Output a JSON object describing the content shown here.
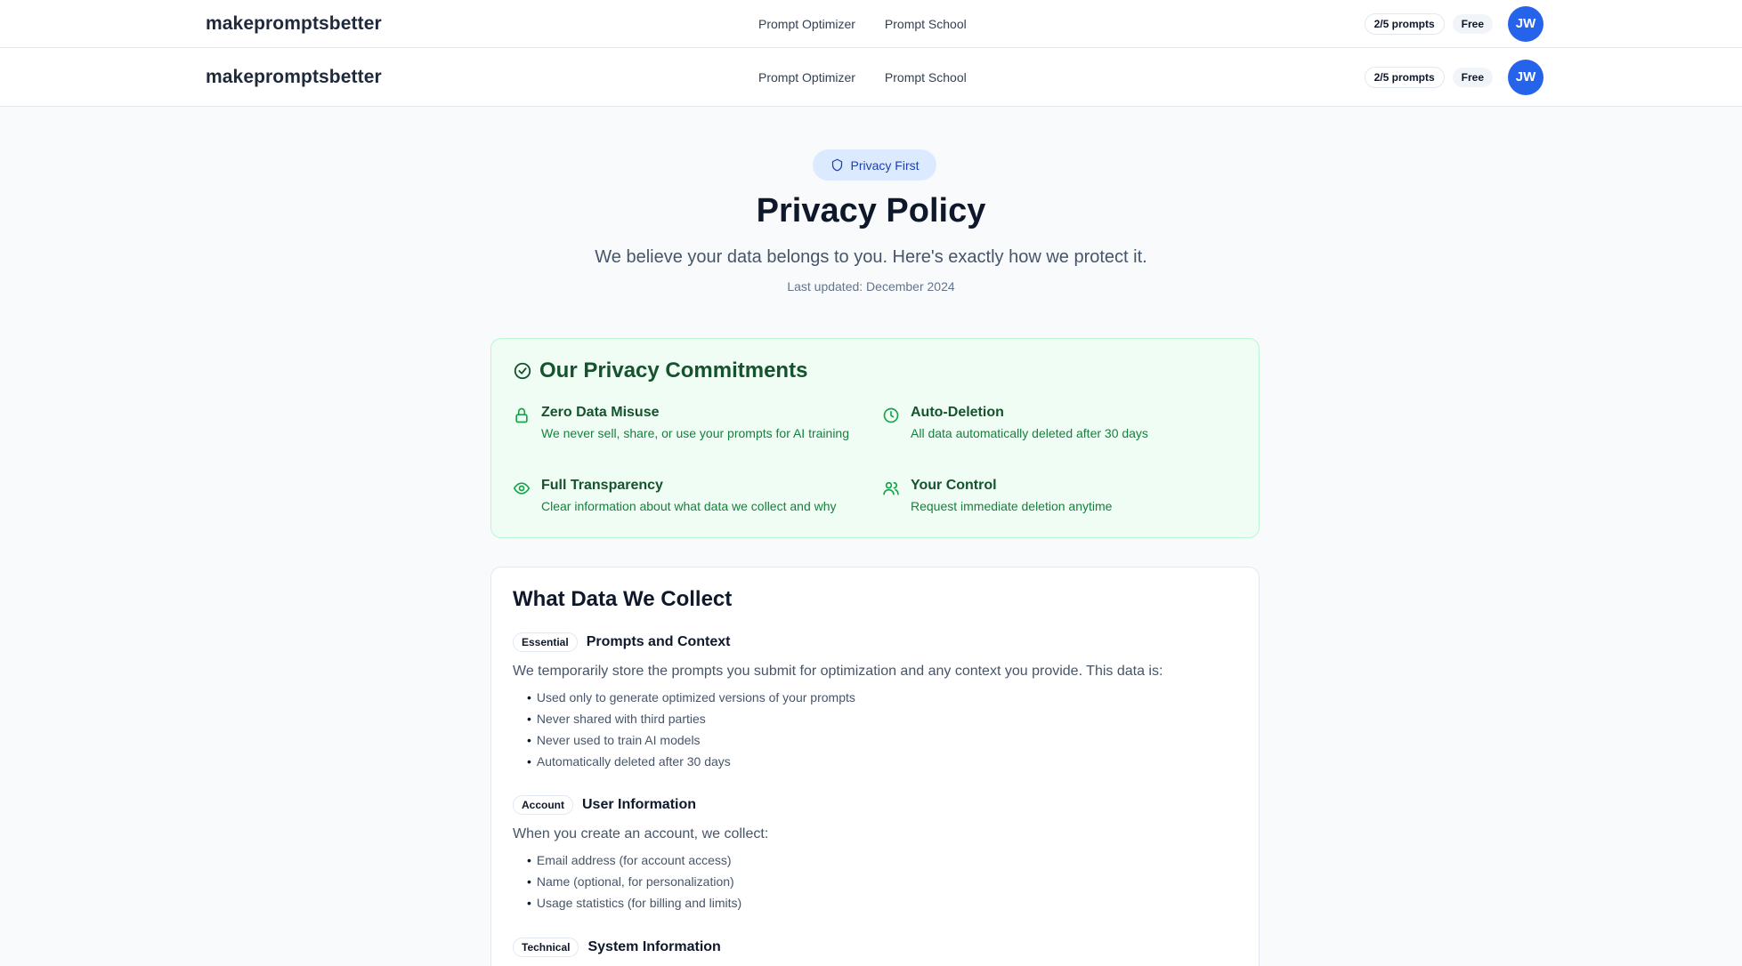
{
  "navbar": {
    "brand": "makepromptsbetter",
    "links": [
      "Prompt Optimizer",
      "Prompt School"
    ],
    "usage": "2/5 prompts",
    "plan": "Free",
    "avatar_initials": "JW"
  },
  "hero": {
    "badge": "Privacy First",
    "title": "Privacy Policy",
    "subtitle": "We believe your data belongs to you. Here's exactly how we protect it.",
    "updated": "Last updated: December 2024"
  },
  "commitments": {
    "title": "Our Privacy Commitments",
    "items": [
      {
        "title": "Zero Data Misuse",
        "desc": "We never sell, share, or use your prompts for AI training",
        "icon": "lock-icon"
      },
      {
        "title": "Auto-Deletion",
        "desc": "All data automatically deleted after 30 days",
        "icon": "clock-icon"
      },
      {
        "title": "Full Transparency",
        "desc": "Clear information about what data we collect and why",
        "icon": "eye-icon"
      },
      {
        "title": "Your Control",
        "desc": "Request immediate deletion anytime",
        "icon": "users-icon"
      }
    ]
  },
  "data_collect": {
    "title": "What Data We Collect",
    "groups": [
      {
        "tag": "Essential",
        "title": "Prompts and Context",
        "desc": "We temporarily store the prompts you submit for optimization and any context you provide. This data is:",
        "bullets": [
          "Used only to generate optimized versions of your prompts",
          "Never shared with third parties",
          "Never used to train AI models",
          "Automatically deleted after 30 days"
        ]
      },
      {
        "tag": "Account",
        "title": "User Information",
        "desc": "When you create an account, we collect:",
        "bullets": [
          "Email address (for account access)",
          "Name (optional, for personalization)",
          "Usage statistics (for billing and limits)"
        ]
      },
      {
        "tag": "Technical",
        "title": "System Information"
      }
    ]
  },
  "colors": {
    "accent": "#2563eb",
    "success_bg": "#f0fdf4",
    "success_text": "#14532d"
  }
}
